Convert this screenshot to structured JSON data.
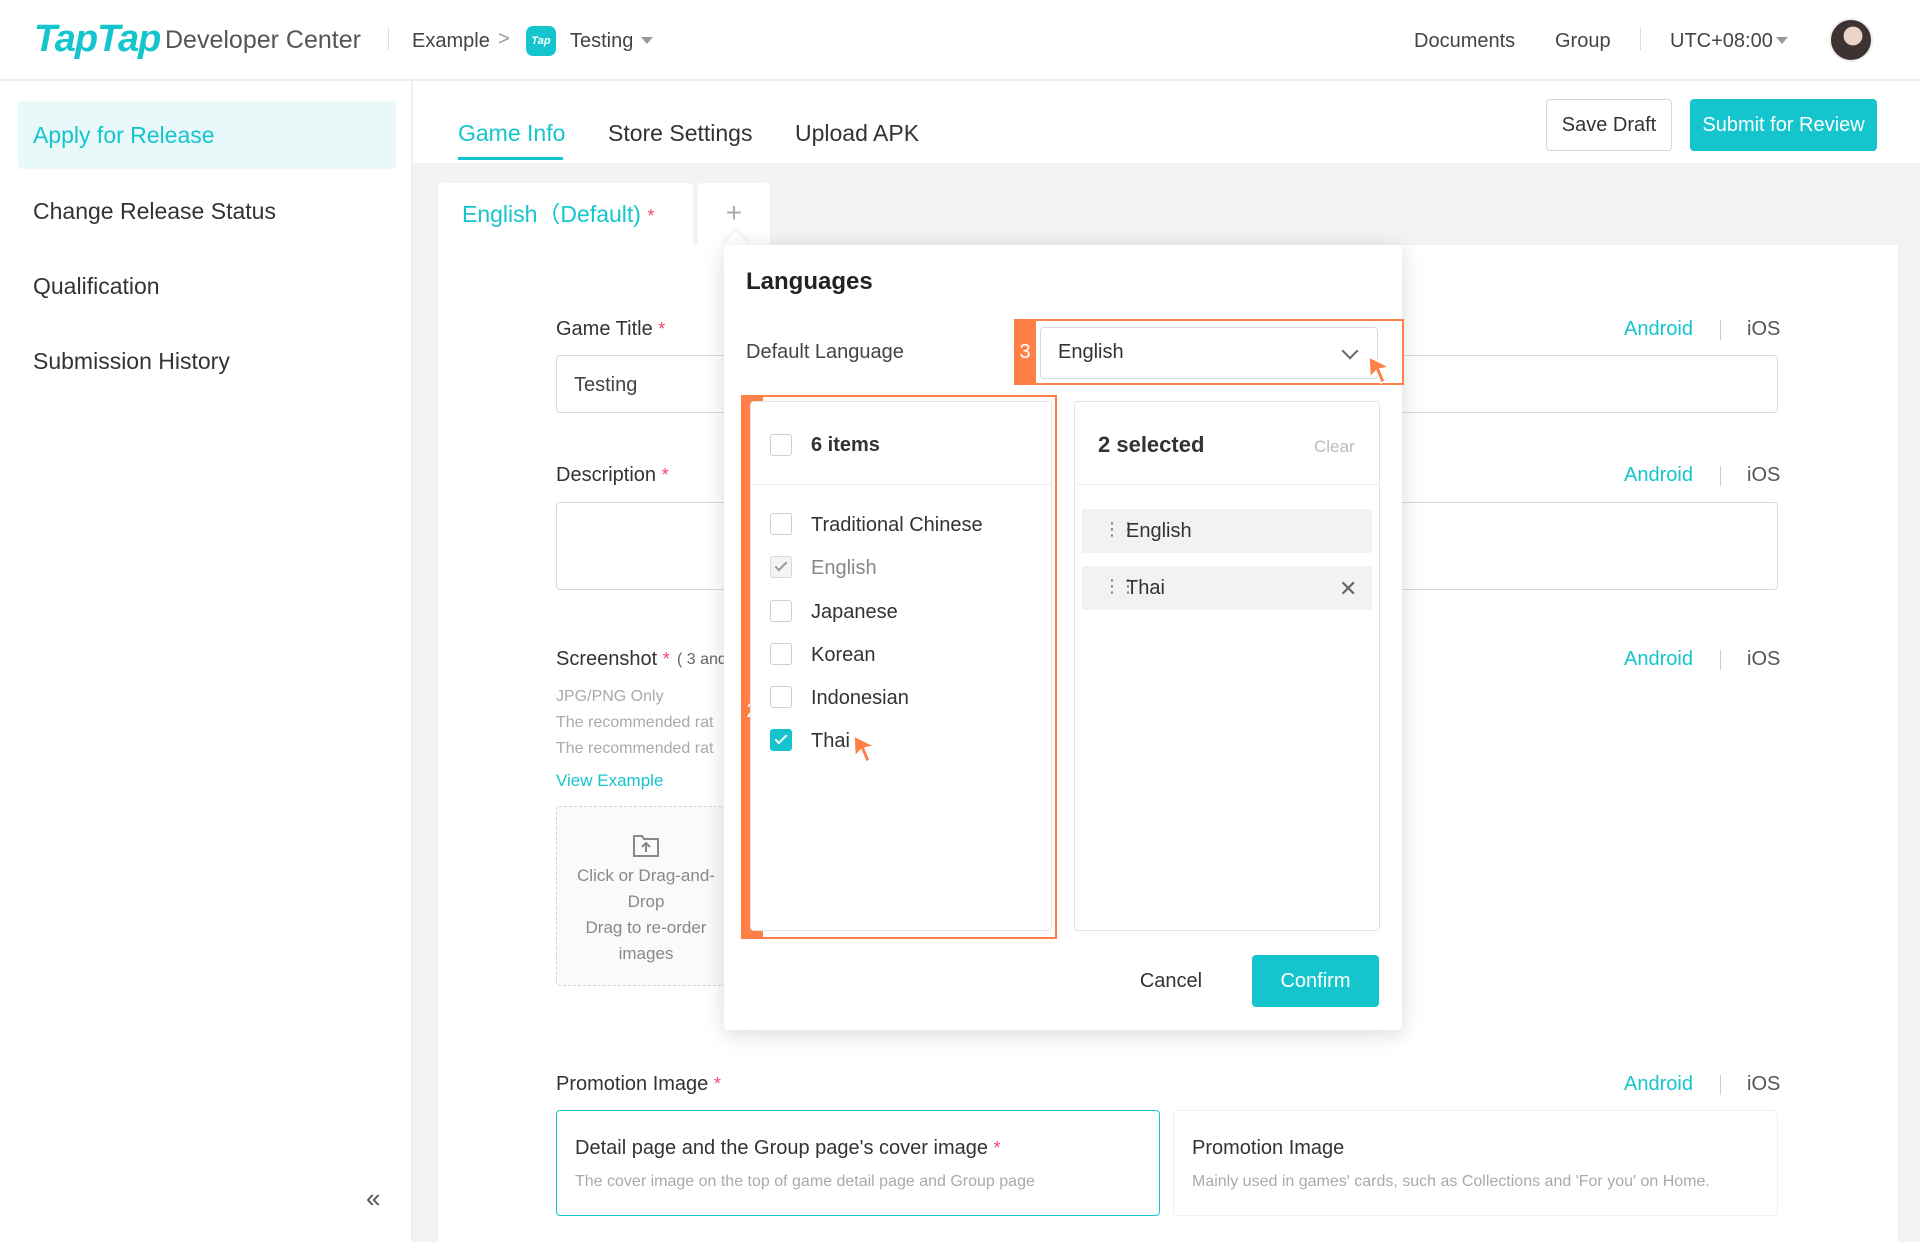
{
  "header": {
    "logo": "TapTap",
    "subtitle": "Developer Center",
    "breadcrumb": {
      "example": "Example",
      "chevron": ">",
      "badge": "Tap",
      "project": "Testing"
    },
    "nav": {
      "documents": "Documents",
      "group": "Group",
      "timezone": "UTC+08:00"
    }
  },
  "sidebar": {
    "items": [
      {
        "label": "Apply for Release",
        "active": true
      },
      {
        "label": "Change Release Status",
        "active": false
      },
      {
        "label": "Qualification",
        "active": false
      },
      {
        "label": "Submission History",
        "active": false
      }
    ],
    "collapse_glyph": "«"
  },
  "tabs": [
    {
      "label": "Game Info",
      "active": true
    },
    {
      "label": "Store Settings",
      "active": false
    },
    {
      "label": "Upload APK",
      "active": false
    }
  ],
  "actions": {
    "save_draft": "Save Draft",
    "submit": "Submit for Review"
  },
  "language_tabs": {
    "current": "English（Default)",
    "required_mark": "*",
    "add_glyph": "+"
  },
  "form": {
    "platform": {
      "android": "Android",
      "ios": "iOS"
    },
    "game_title": {
      "label": "Game Title",
      "value": "Testing"
    },
    "description": {
      "label": "Description",
      "value": ""
    },
    "screenshot": {
      "label": "Screenshot",
      "note": "( 3 and",
      "hints": [
        "JPG/PNG Only",
        "The recommended rat",
        "The recommended rat"
      ],
      "example_link": "View Example",
      "upload_text": [
        "Click or Drag-and-",
        "Drop",
        "Drag to re-order",
        "images"
      ]
    },
    "promotion": {
      "label": "Promotion Image",
      "cards": [
        {
          "title": "Detail page and the Group page's cover image",
          "subtitle": "The cover image on the top of game detail page and Group page",
          "selected": true
        },
        {
          "title": "Promotion Image",
          "subtitle": "Mainly used in games' cards, such as Collections and 'For you' on Home.",
          "selected": false
        }
      ]
    }
  },
  "popup": {
    "title": "Languages",
    "default_language_label": "Default Language",
    "default_language_value": "English",
    "source": {
      "header": "6 items",
      "options": [
        {
          "label": "Traditional Chinese",
          "state": "unchecked"
        },
        {
          "label": "English",
          "state": "disabled-checked"
        },
        {
          "label": "Japanese",
          "state": "unchecked"
        },
        {
          "label": "Korean",
          "state": "unchecked"
        },
        {
          "label": "Indonesian",
          "state": "unchecked"
        },
        {
          "label": "Thai",
          "state": "checked"
        }
      ]
    },
    "target": {
      "header": "2 selected",
      "clear": "Clear",
      "items": [
        {
          "label": "English",
          "removable": false
        },
        {
          "label": "Thai",
          "removable": true
        }
      ],
      "drag_glyph": "⋮⋮",
      "remove_glyph": "✕"
    },
    "cancel": "Cancel",
    "confirm": "Confirm"
  },
  "annotations": {
    "step2": "2",
    "step3": "3",
    "color": "#ff8047"
  },
  "colors": {
    "brand": "#15c5ce",
    "required": "#f04864",
    "highlight": "#ff8047"
  }
}
